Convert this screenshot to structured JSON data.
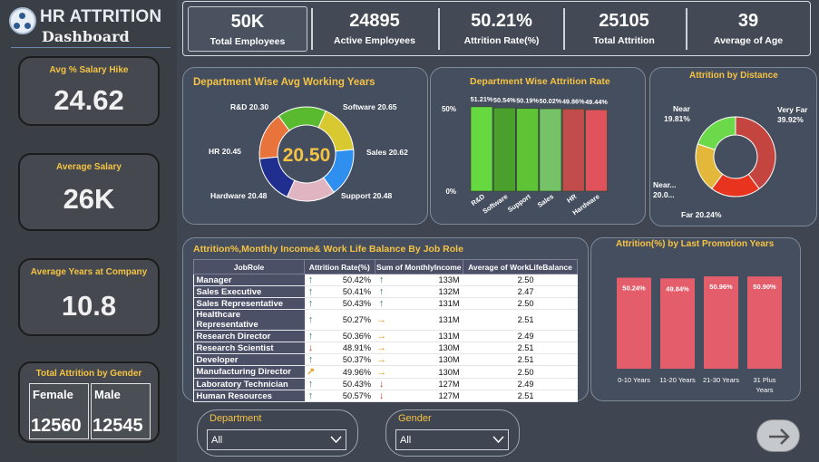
{
  "header": {
    "title": "HR ATTRITION",
    "subtitle": "Dashboard",
    "logo_icon": "people-network-icon"
  },
  "sidebar_kpis": [
    {
      "label": "Avg % Salary Hike",
      "value": "24.62"
    },
    {
      "label": "Average Salary",
      "value": "26K"
    },
    {
      "label": "Average Years at Company",
      "value": "10.8"
    }
  ],
  "gender_card": {
    "title": "Total Attrition by Gender",
    "female_label": "Female",
    "female_value": "12560",
    "male_label": "Male",
    "male_value": "12545"
  },
  "top_kpis": [
    {
      "value": "50K",
      "label": "Total Employees"
    },
    {
      "value": "24895",
      "label": "Active Employees"
    },
    {
      "value": "50.21%",
      "label": "Attrition Rate(%)"
    },
    {
      "value": "25105",
      "label": "Total Attrition"
    },
    {
      "value": "39",
      "label": "Average of Age"
    }
  ],
  "colors": {
    "accent": "#f5c343",
    "panel": "#454e5e",
    "background": "#3f4652"
  },
  "chart_data": [
    {
      "type": "pie",
      "title": "Department Wise Avg Working Years",
      "center_label": "20.50",
      "categories": [
        "R&D",
        "Software",
        "Sales",
        "Support",
        "Hardware",
        "HR"
      ],
      "values": [
        20.3,
        20.65,
        20.62,
        20.48,
        20.48,
        20.45
      ],
      "colors": [
        "#e8743b",
        "#5aba2f",
        "#d9c930",
        "#2e8fef",
        "#e0b4c0",
        "#1f2e8f"
      ]
    },
    {
      "type": "bar",
      "title": "Department Wise Attrition Rate",
      "categories": [
        "R&D",
        "Software",
        "Support",
        "Sales",
        "HR",
        "Hardware"
      ],
      "values": [
        51.21,
        50.54,
        50.19,
        50.02,
        49.86,
        49.44
      ],
      "value_labels": [
        "51.21%",
        "50.54%",
        "50.19%",
        "50.02%",
        "49.86%",
        "49.44%"
      ],
      "yticks": [
        "50%",
        "0%"
      ],
      "ylim": [
        0,
        55
      ],
      "colors": [
        "#66d940",
        "#4b9f2c",
        "#5ec436",
        "#76c267",
        "#c24c4c",
        "#e0525c"
      ]
    },
    {
      "type": "pie",
      "title": "Attrition by Distance",
      "categories": [
        "Very Far",
        "Far",
        "Near...",
        "Near"
      ],
      "values": [
        39.92,
        20.24,
        20.03,
        19.81
      ],
      "labels": [
        "Very Far 39.92%",
        "Far 20.24%",
        "Near... 20.0...",
        "Near 19.81%"
      ],
      "colors": [
        "#c4453f",
        "#e8331f",
        "#e3b73a",
        "#6bd94a"
      ]
    },
    {
      "type": "bar",
      "title": "Attrition(%) by Last Promotion Years",
      "categories": [
        "0-10 Years",
        "11-20 Years",
        "21-30 Years",
        "31 Plus Years"
      ],
      "values": [
        50.24,
        49.84,
        50.96,
        50.9
      ],
      "value_labels": [
        "50.24%",
        "49.84%",
        "50.96%",
        "50.90%"
      ],
      "ylim": [
        0,
        52
      ],
      "colors": [
        "#e35d6a",
        "#e35d6a",
        "#e35d6a",
        "#e35d6a"
      ]
    },
    {
      "type": "table",
      "title": "Attrition%,Monthly Income& Work Life Balance By Job Role",
      "columns": [
        "JobRole",
        "Attrition Rate(%)",
        "Sum of MonthlyIncome",
        "Average of WorkLifeBalance"
      ],
      "rows": [
        {
          "role": "Manager",
          "rate": "50.42%",
          "rate_icon": "up",
          "income": "133M",
          "income_icon": "up",
          "wlb": "2.50"
        },
        {
          "role": "Sales Executive",
          "rate": "50.41%",
          "rate_icon": "up",
          "income": "132M",
          "income_icon": "up",
          "wlb": "2.47"
        },
        {
          "role": "Sales Representative",
          "rate": "50.43%",
          "rate_icon": "up",
          "income": "131M",
          "income_icon": "up",
          "wlb": "2.50"
        },
        {
          "role": "Healthcare Representative",
          "rate": "50.27%",
          "rate_icon": "up",
          "income": "131M",
          "income_icon": "right",
          "wlb": "2.51"
        },
        {
          "role": "Research Director",
          "rate": "50.36%",
          "rate_icon": "up",
          "income": "131M",
          "income_icon": "right",
          "wlb": "2.49"
        },
        {
          "role": "Research Scientist",
          "rate": "48.91%",
          "rate_icon": "down",
          "income": "130M",
          "income_icon": "right",
          "wlb": "2.51"
        },
        {
          "role": "Developer",
          "rate": "50.37%",
          "rate_icon": "up",
          "income": "130M",
          "income_icon": "right",
          "wlb": "2.51"
        },
        {
          "role": "Manufacturing Director",
          "rate": "49.96%",
          "rate_icon": "diag",
          "income": "130M",
          "income_icon": "right",
          "wlb": "2.50"
        },
        {
          "role": "Laboratory Technician",
          "rate": "50.43%",
          "rate_icon": "up",
          "income": "127M",
          "income_icon": "down",
          "wlb": "2.49"
        },
        {
          "role": "Human Resources",
          "rate": "50.57%",
          "rate_icon": "up",
          "income": "127M",
          "income_icon": "down",
          "wlb": "2.51"
        }
      ]
    }
  ],
  "slicers": [
    {
      "label": "Department",
      "value": "All"
    },
    {
      "label": "Gender",
      "value": "All"
    }
  ],
  "next_button_icon": "arrow-right-icon"
}
